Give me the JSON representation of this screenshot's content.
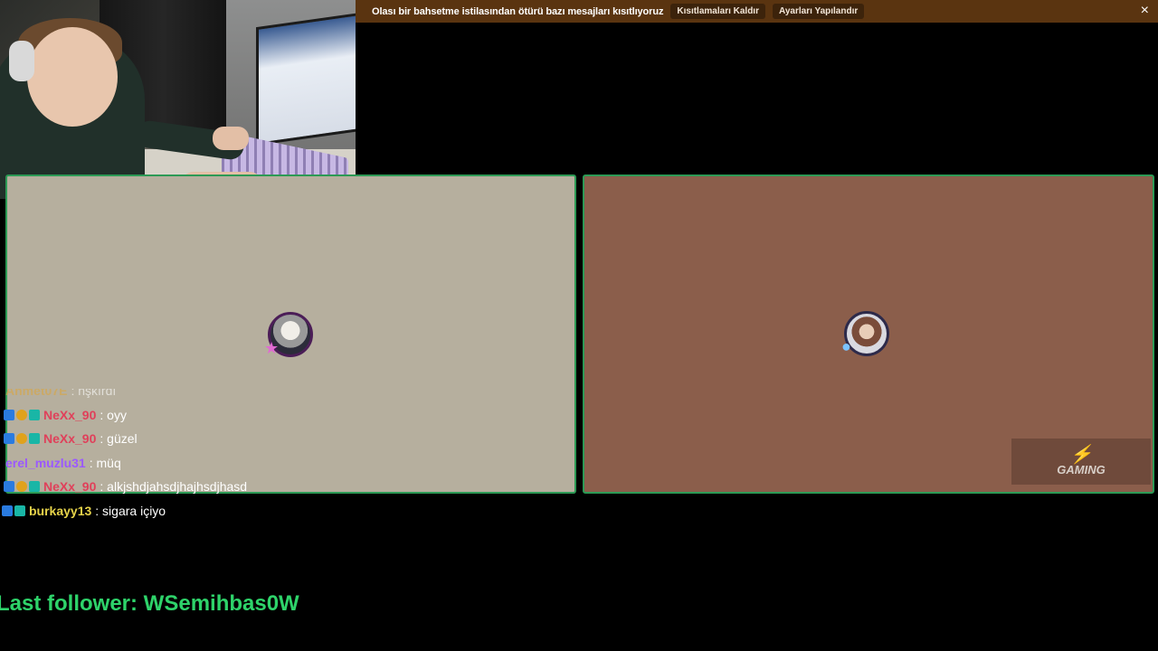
{
  "banner": {
    "message": "Olası bir bahsetme istilasından ötürü bazı mesajları kısıtlıyoruz",
    "remove_button": "Kısıtlamaları Kaldır",
    "settings_button": "Ayarları Yapılandır",
    "close_icon": "×"
  },
  "chat": {
    "messages": [
      {
        "user": "Ahmet07E",
        "text": ": hşkırdı",
        "user_color": "#d9a641",
        "badges": []
      },
      {
        "user": "NeXx_90",
        "text": ": oyy",
        "user_color": "#e0405a",
        "badges": [
          "prime",
          "gold-coin",
          "gift"
        ]
      },
      {
        "user": "NeXx_90",
        "text": ": güzel",
        "user_color": "#e0405a",
        "badges": [
          "prime",
          "gold-coin",
          "gift"
        ]
      },
      {
        "user": "erel_muzlu31",
        "text": ": müq",
        "user_color": "#9b59ff",
        "badges": []
      },
      {
        "user": "NeXx_90",
        "text": ": alkjshdjahsdjhajhsdjhasd",
        "user_color": "#e0405a",
        "badges": [
          "prime",
          "gold-coin",
          "gift"
        ]
      },
      {
        "user": "burkayy13",
        "text": ": sigara içiyo",
        "user_color": "#e6d34a",
        "badges": [
          "prime",
          "gift"
        ]
      }
    ]
  },
  "panels": {
    "left": {
      "avatar_icon": "user-avatar-icon",
      "color": "#b6af9e"
    },
    "right": {
      "avatar_icon": "user-avatar-icon",
      "color": "#8b5e4b"
    }
  },
  "brand": {
    "logo_text": "GAMING"
  },
  "follower": {
    "text": "Last follower: WSemihbas0W"
  }
}
